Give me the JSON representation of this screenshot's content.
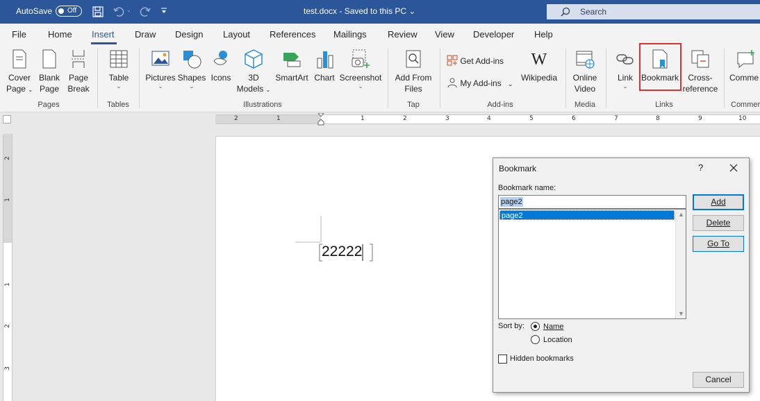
{
  "titlebar": {
    "autosave_label": "AutoSave",
    "autosave_state": "Off",
    "document_title": "test.docx  -  Saved to this PC  ⌄",
    "search_placeholder": "Search",
    "bg_color": "#2b579a"
  },
  "menu": {
    "tabs": [
      "File",
      "Home",
      "Insert",
      "Draw",
      "Design",
      "Layout",
      "References",
      "Mailings",
      "Review",
      "View",
      "Developer",
      "Help"
    ],
    "active_tab": "Insert"
  },
  "ribbon": {
    "pages": {
      "cover_l1": "Cover",
      "cover_l2": "Page",
      "blank_l1": "Blank",
      "blank_l2": "Page",
      "break_l1": "Page",
      "break_l2": "Break",
      "group": "Pages"
    },
    "tables": {
      "table": "Table",
      "group": "Tables"
    },
    "illustrations": {
      "pictures": "Pictures",
      "shapes": "Shapes",
      "icons": "Icons",
      "models_l1": "3D",
      "models_l2": "Models",
      "smartart": "SmartArt",
      "chart": "Chart",
      "screenshot": "Screenshot",
      "group": "Illustrations"
    },
    "tap": {
      "l1": "Add From",
      "l2": "Files",
      "group": "Tap"
    },
    "addins": {
      "get": "Get Add-ins",
      "my": "My Add-ins",
      "wikipedia": "Wikipedia",
      "group": "Add-ins"
    },
    "media": {
      "l1": "Online",
      "l2": "Video",
      "group": "Media"
    },
    "links": {
      "link": "Link",
      "bookmark": "Bookmark",
      "cross_l1": "Cross-",
      "cross_l2": "reference",
      "group": "Links"
    },
    "comments": {
      "label": "Comme",
      "group": "Commer"
    }
  },
  "ruler": {
    "h_numbers": [
      "2",
      "1",
      "1",
      "2",
      "3",
      "4",
      "5",
      "6",
      "7",
      "8",
      "9",
      "10"
    ],
    "v_numbers": [
      "2",
      "1",
      "1",
      "2",
      "3"
    ]
  },
  "document": {
    "text": "22222"
  },
  "dialog": {
    "title": "Bookmark",
    "help": "?",
    "name_label": "Bookmark name:",
    "name_value": "page2",
    "list_items": [
      "page2"
    ],
    "add_button": "Add",
    "delete_button": "Delete",
    "goto_button": "Go To",
    "cancel_button": "Cancel",
    "sort_by_label": "Sort by:",
    "sort_name": "Name",
    "sort_location": "Location",
    "sort_selected": "Name",
    "hidden_label": "Hidden bookmarks",
    "hidden_checked": false
  }
}
